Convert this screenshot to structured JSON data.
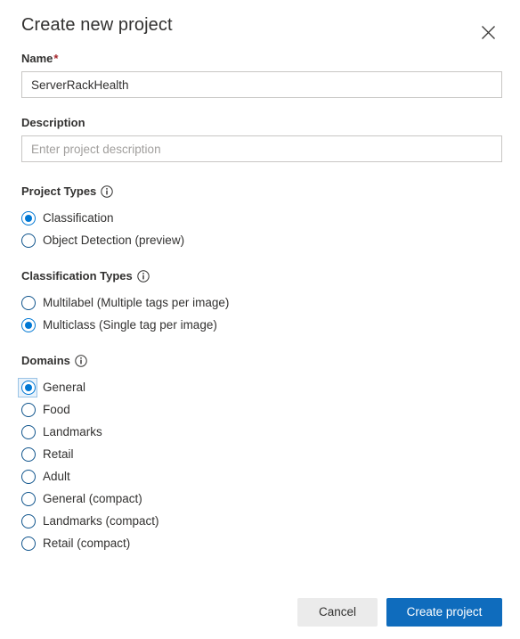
{
  "dialog": {
    "title": "Create new project",
    "close_icon": "close-icon"
  },
  "name_field": {
    "label": "Name",
    "required_marker": "*",
    "value": "ServerRackHealth",
    "placeholder": ""
  },
  "description_field": {
    "label": "Description",
    "value": "",
    "placeholder": "Enter project description"
  },
  "project_types": {
    "heading": "Project Types",
    "info_icon": "info-icon",
    "options": [
      {
        "label": "Classification",
        "selected": true
      },
      {
        "label": "Object Detection (preview)",
        "selected": false
      }
    ]
  },
  "classification_types": {
    "heading": "Classification Types",
    "info_icon": "info-icon",
    "options": [
      {
        "label": "Multilabel (Multiple tags per image)",
        "selected": false
      },
      {
        "label": "Multiclass (Single tag per image)",
        "selected": true
      }
    ]
  },
  "domains": {
    "heading": "Domains",
    "info_icon": "info-icon",
    "options": [
      {
        "label": "General",
        "selected": true,
        "focused": true
      },
      {
        "label": "Food",
        "selected": false,
        "focused": false
      },
      {
        "label": "Landmarks",
        "selected": false,
        "focused": false
      },
      {
        "label": "Retail",
        "selected": false,
        "focused": false
      },
      {
        "label": "Adult",
        "selected": false,
        "focused": false
      },
      {
        "label": "General (compact)",
        "selected": false,
        "focused": false
      },
      {
        "label": "Landmarks (compact)",
        "selected": false,
        "focused": false
      },
      {
        "label": "Retail (compact)",
        "selected": false,
        "focused": false
      }
    ]
  },
  "footer": {
    "cancel_label": "Cancel",
    "create_label": "Create project"
  },
  "colors": {
    "accent": "#0078d4",
    "primary_button": "#0f6cbd",
    "required_star": "#a4262c",
    "border": "#c8c6c4",
    "text": "#323130",
    "placeholder": "#a19f9d"
  }
}
